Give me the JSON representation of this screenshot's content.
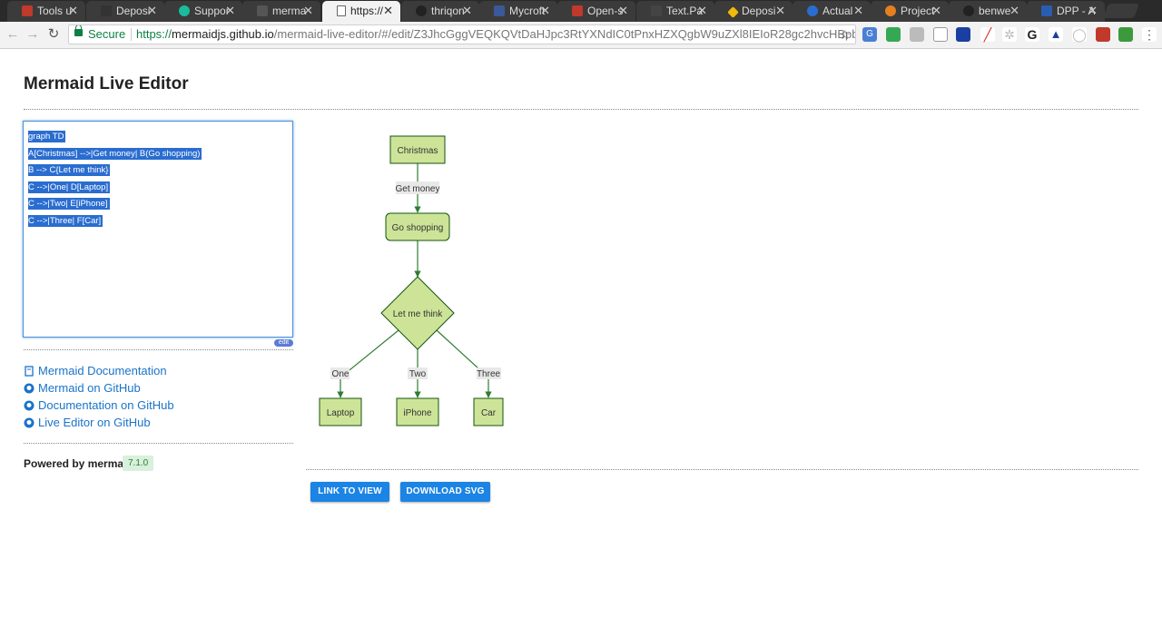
{
  "browser": {
    "tabs": [
      {
        "title": "Tools u",
        "color": "#c0392b"
      },
      {
        "title": "Deposi",
        "color": "#333333"
      },
      {
        "title": "Suppor",
        "color": "#1abc9c"
      },
      {
        "title": "merma",
        "color": "#555555"
      },
      {
        "title": "https://",
        "color": "#ffffff",
        "active": true
      },
      {
        "title": "thriqon",
        "color": "#222222"
      },
      {
        "title": "Mycroft",
        "color": "#3b5998"
      },
      {
        "title": "Open-s",
        "color": "#c0392b"
      },
      {
        "title": "Text.Pa",
        "color": "#444444"
      },
      {
        "title": "Deposi",
        "color": "#f0b90b"
      },
      {
        "title": "Actual",
        "color": "#2a6dd0"
      },
      {
        "title": "Project",
        "color": "#e67e22"
      },
      {
        "title": "benwe",
        "color": "#222222"
      },
      {
        "title": "DPP - A",
        "color": "#2a5db0"
      }
    ],
    "secure_label": "Secure",
    "url_scheme": "https://",
    "url_host": "mermaidjs.github.io",
    "url_path": "/mermaid-live-editor/#/edit/Z3JhcGggVEQKQVtDaHJpc3RtYXNdIC0tPnxHZXQgbW9uZXl8IEIoR28gc2hvcHBpb"
  },
  "page": {
    "title": "Mermaid Live Editor",
    "editor_lines": [
      "graph TD",
      "A[Christmas] -->|Get money| B(Go shopping)",
      "B --> C{Let me think}",
      "C -->|One| D[Laptop]",
      "C -->|Two| E[iPhone]",
      "C -->|Three| F[Car]"
    ],
    "edit_badge": "edit",
    "links": [
      {
        "label": "Mermaid Documentation",
        "icon": "book-icon"
      },
      {
        "label": "Mermaid on GitHub",
        "icon": "github-icon"
      },
      {
        "label": "Documentation on GitHub",
        "icon": "github-icon"
      },
      {
        "label": "Live Editor on GitHub",
        "icon": "github-icon"
      }
    ],
    "powered_by": "Powered by mermaid",
    "version": "7.1.0",
    "buttons": {
      "link_to_view": "LINK TO VIEW",
      "download_svg": "DOWNLOAD SVG"
    }
  },
  "diagram": {
    "nodes": {
      "christmas": "Christmas",
      "go_shopping": "Go shopping",
      "let_me_think": "Let me think",
      "laptop": "Laptop",
      "iphone": "iPhone",
      "car": "Car"
    },
    "edge_labels": {
      "get_money": "Get money",
      "one": "One",
      "two": "Two",
      "three": "Three"
    },
    "colors": {
      "node_fill": "#cde498",
      "node_stroke": "#13540c",
      "edge": "#2e7d32",
      "label_bg": "#e8e8e8"
    }
  },
  "colors": {
    "accent": "#1b84e4",
    "link": "#1a73c9",
    "secure": "#0b8043"
  }
}
